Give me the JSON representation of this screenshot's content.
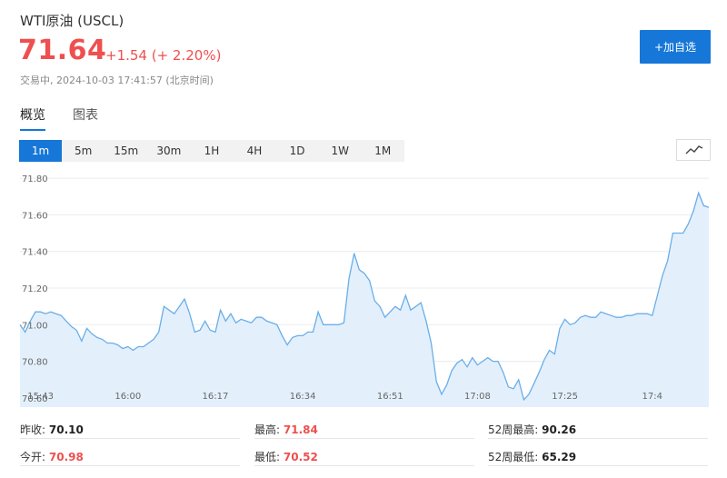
{
  "header": {
    "title": "WTI原油 (USCL)",
    "price": "71.64",
    "change": "+1.54 (+ 2.20%)",
    "status": "交易中, 2024-10-03 17:41:57 (北京时间)",
    "add_button": "+加自选"
  },
  "tabs": [
    {
      "label": "概览",
      "active": true
    },
    {
      "label": "图表",
      "active": false
    }
  ],
  "periods": [
    "1m",
    "5m",
    "15m",
    "30m",
    "1H",
    "4H",
    "1D",
    "1W",
    "1M"
  ],
  "active_period": "1m",
  "chart_data": {
    "type": "area",
    "ylim": [
      70.55,
      71.85
    ],
    "yticks": [
      "71.80",
      "71.60",
      "71.40",
      "71.20",
      "71.00",
      "70.80",
      "70.60"
    ],
    "ytick_values": [
      71.8,
      71.6,
      71.4,
      71.2,
      71.0,
      70.8,
      70.6
    ],
    "xticks": [
      "15:43",
      "16:00",
      "16:17",
      "16:34",
      "16:51",
      "17:08",
      "17:25",
      "17:4"
    ],
    "xtick_index": [
      4,
      21,
      38,
      55,
      72,
      89,
      106,
      123
    ],
    "line_color": "#6aaee8",
    "fill_color": "#e3f0fc",
    "values": [
      71.0,
      70.96,
      71.02,
      71.07,
      71.07,
      71.06,
      71.07,
      71.06,
      71.05,
      71.02,
      70.99,
      70.97,
      70.91,
      70.98,
      70.95,
      70.93,
      70.92,
      70.9,
      70.9,
      70.89,
      70.87,
      70.88,
      70.86,
      70.88,
      70.88,
      70.9,
      70.92,
      70.96,
      71.1,
      71.08,
      71.06,
      71.1,
      71.14,
      71.06,
      70.96,
      70.97,
      71.02,
      70.97,
      70.96,
      71.08,
      71.02,
      71.06,
      71.01,
      71.03,
      71.02,
      71.01,
      71.04,
      71.04,
      71.02,
      71.01,
      71.0,
      70.94,
      70.89,
      70.93,
      70.94,
      70.94,
      70.96,
      70.96,
      71.07,
      71.0,
      71.0,
      71.0,
      71.0,
      71.01,
      71.25,
      71.39,
      71.3,
      71.28,
      71.24,
      71.13,
      71.1,
      71.04,
      71.07,
      71.1,
      71.08,
      71.16,
      71.08,
      71.1,
      71.12,
      71.02,
      70.9,
      70.69,
      70.62,
      70.67,
      70.75,
      70.79,
      70.81,
      70.77,
      70.82,
      70.78,
      70.8,
      70.82,
      70.8,
      70.8,
      70.74,
      70.66,
      70.65,
      70.7,
      70.59,
      70.62,
      70.68,
      70.74,
      70.81,
      70.86,
      70.84,
      70.98,
      71.03,
      71.0,
      71.01,
      71.04,
      71.05,
      71.04,
      71.04,
      71.07,
      71.06,
      71.05,
      71.04,
      71.04,
      71.05,
      71.05,
      71.06,
      71.06,
      71.06,
      71.05,
      71.16,
      71.27,
      71.35,
      71.5,
      71.5,
      71.5,
      71.55,
      71.62,
      71.72,
      71.65,
      71.64
    ]
  },
  "stats": {
    "prev_close_label": "昨收:",
    "prev_close": "70.10",
    "high_label": "最高:",
    "high": "71.84",
    "week52_high_label": "52周最高:",
    "week52_high": "90.26",
    "open_label": "今开:",
    "open": "70.98",
    "low_label": "最低:",
    "low": "70.52",
    "week52_low_label": "52周最低:",
    "week52_low": "65.29"
  }
}
